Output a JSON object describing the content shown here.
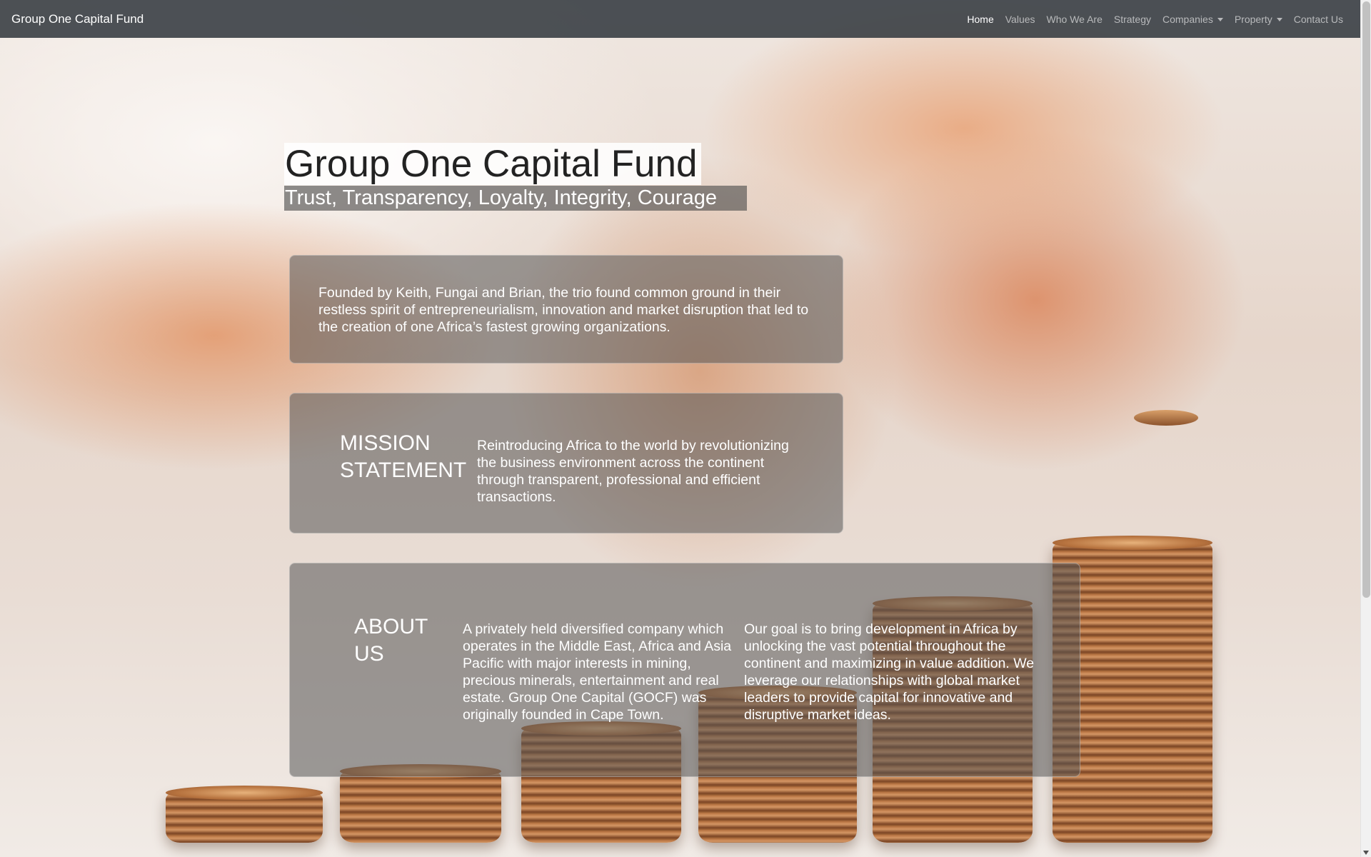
{
  "navbar": {
    "brand": "Group One Capital Fund",
    "links": [
      {
        "label": "Home",
        "active": true
      },
      {
        "label": "Values"
      },
      {
        "label": "Who We Are"
      },
      {
        "label": "Strategy"
      },
      {
        "label": "Companies",
        "dropdown": true
      },
      {
        "label": "Property",
        "dropdown": true
      },
      {
        "label": "Contact Us"
      }
    ]
  },
  "hero": {
    "title": "Group One Capital Fund",
    "subtitle": "Trust, Transparency, Loyalty, Integrity, Courage"
  },
  "founded": {
    "text": "Founded by Keith, Fungai and Brian, the trio found common ground in their restless spirit of entrepreneurialism, innovation and market disruption that led to the creation of one Africa’s fastest growing organizations."
  },
  "mission": {
    "heading": "MISSION STATEMENT",
    "text": "Reintroducing Africa to the world by revolutionizing the business environment across the continent through transparent, professional and efficient transactions."
  },
  "about": {
    "heading": "ABOUT US",
    "text_1": "A privately held diversified company which operates in the Middle East, Africa and Asia Pacific with major interests in mining, precious minerals, entertainment and real estate. Group One Capital (GOCF) was originally founded in Cape Town.",
    "text_2": "Our goal is to bring development in Africa by unlocking the vast potential throughout the continent and maximizing in value addition. We leverage our relationships with global market leaders to provide capital for innovative and disruptive market ideas."
  },
  "colors": {
    "navbar_bg": "#343a40",
    "card_bg": "#555555",
    "coin": "#b36f3e"
  }
}
